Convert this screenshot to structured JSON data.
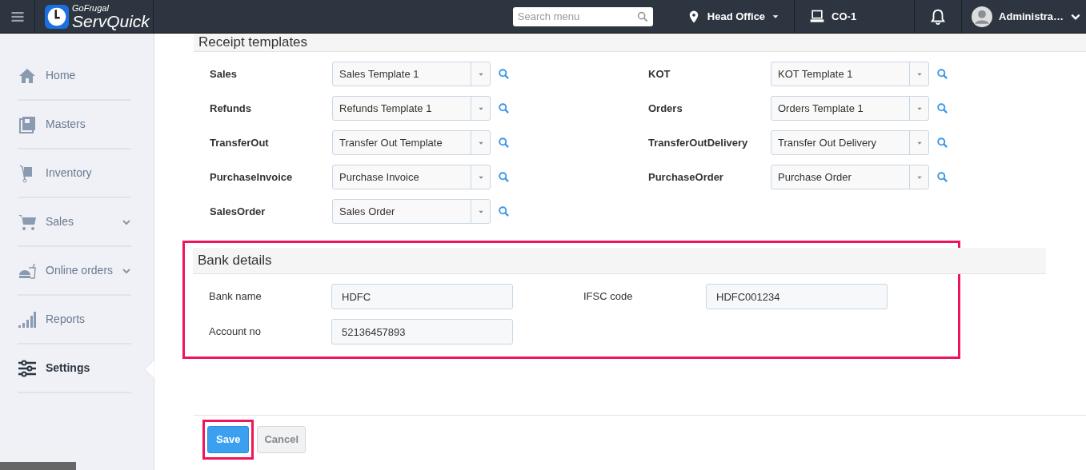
{
  "logo": {
    "brand": "GoFrugal",
    "product": "ServQuick"
  },
  "topbar": {
    "search": {
      "placeholder": "Search menu"
    },
    "location": "Head Office",
    "terminal": "CO-1",
    "user": "Administra…"
  },
  "sidebar": {
    "items": [
      {
        "label": "Home",
        "selected": false,
        "expandable": false
      },
      {
        "label": "Masters",
        "selected": false,
        "expandable": false
      },
      {
        "label": "Inventory",
        "selected": false,
        "expandable": false
      },
      {
        "label": "Sales",
        "selected": false,
        "expandable": true
      },
      {
        "label": "Online orders",
        "selected": false,
        "expandable": true
      },
      {
        "label": "Reports",
        "selected": false,
        "expandable": false
      },
      {
        "label": "Settings",
        "selected": true,
        "expandable": false
      }
    ]
  },
  "receipt_templates": {
    "title": "Receipt templates",
    "left": [
      {
        "label": "Sales",
        "value": "Sales Template 1"
      },
      {
        "label": "Refunds",
        "value": "Refunds Template 1"
      },
      {
        "label": "TransferOut",
        "value": "Transfer Out Template"
      },
      {
        "label": "PurchaseInvoice",
        "value": "Purchase Invoice"
      },
      {
        "label": "SalesOrder",
        "value": "Sales Order"
      }
    ],
    "right": [
      {
        "label": "KOT",
        "value": "KOT Template 1"
      },
      {
        "label": "Orders",
        "value": "Orders Template 1"
      },
      {
        "label": "TransferOutDelivery",
        "value": "Transfer Out Delivery"
      },
      {
        "label": "PurchaseOrder",
        "value": "Purchase Order"
      }
    ]
  },
  "bank_details": {
    "title": "Bank details",
    "highlighted": true,
    "left": [
      {
        "label": "Bank name",
        "value": "HDFC"
      },
      {
        "label": "Account no",
        "value": "52136457893"
      }
    ],
    "right": [
      {
        "label": "IFSC code",
        "value": "HDFC001234"
      }
    ]
  },
  "buttons": [
    {
      "label": "Save",
      "kind": "primary",
      "highlighted": true
    },
    {
      "label": "Cancel",
      "kind": "secondary",
      "highlighted": false
    }
  ]
}
